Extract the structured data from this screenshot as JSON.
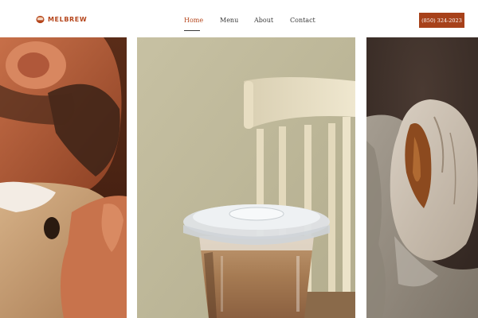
{
  "brand": {
    "name": "MELBREW",
    "accent_color": "#b5461c",
    "logo_icon": "coffee-cup-icon"
  },
  "nav": {
    "items": [
      {
        "label": "Home",
        "active": true
      },
      {
        "label": "Menu",
        "active": false
      },
      {
        "label": "About",
        "active": false
      },
      {
        "label": "Contact",
        "active": false
      }
    ]
  },
  "header": {
    "phone": "(850) 324-2023",
    "button_color": "#a7411a"
  },
  "gallery": {
    "images": [
      {
        "subject": "man-hugging-dog-photo"
      },
      {
        "subject": "iced-coffee-cup-photo"
      },
      {
        "subject": "sourdough-bread-photo"
      }
    ]
  }
}
